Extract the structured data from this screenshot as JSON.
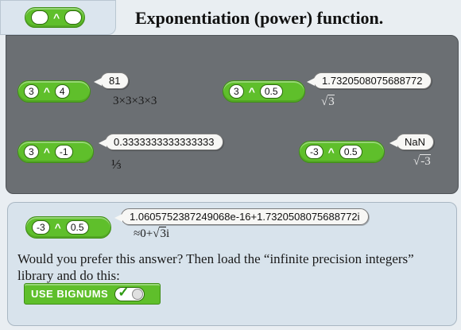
{
  "header": {
    "title": "Exponentiation (power) function.",
    "template_block": {
      "operator": "^"
    }
  },
  "examples": [
    {
      "base": "3",
      "operator": "^",
      "exponent": "4",
      "result": "81",
      "note": "3×3×3×3"
    },
    {
      "base": "3",
      "operator": "^",
      "exponent": "0.5",
      "result": "1.7320508075688772",
      "note_radicand": "3"
    },
    {
      "base": "3",
      "operator": "^",
      "exponent": "-1",
      "result": "0.3333333333333333",
      "note": "⅓"
    },
    {
      "base": "-3",
      "operator": "^",
      "exponent": "0.5",
      "result": "NaN",
      "note_sign": "-",
      "note_radicand": "3"
    }
  ],
  "bignum": {
    "base": "-3",
    "operator": "^",
    "exponent": "0.5",
    "result": "1.0605752387249068e-16+1.7320508075688772i",
    "note_prefix": "≈0+",
    "note_radicand": "3",
    "note_suffix": "i",
    "description": "Would you prefer this answer?  Then load the “infinite precision integers” library and do this:",
    "command_label": "USE BIGNUMS",
    "toggle_mark": "✓"
  },
  "colors": {
    "block_green": "#5fbf2b",
    "dark_panel": "#6b6f73",
    "light_panel": "#d8e3ec"
  }
}
